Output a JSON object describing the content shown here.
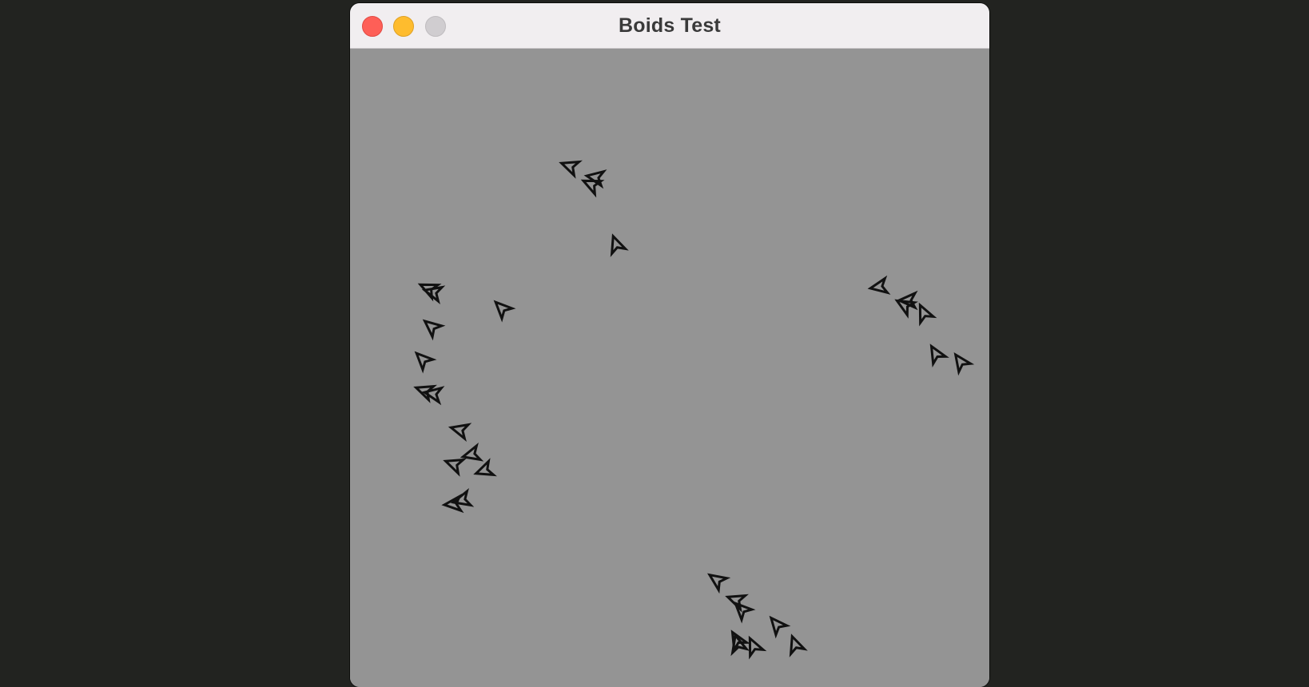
{
  "window": {
    "title": "Boids Test"
  },
  "colors": {
    "desktop": "#222320",
    "titlebar": "#f1eef0",
    "canvas": "#949494",
    "boid_stroke": "#111111",
    "close": "#fe5f57",
    "minimize": "#febc2e",
    "zoom": "#d0cdd0"
  },
  "controls": {
    "close": "close-button",
    "minimize": "minimize-button",
    "zoom": "zoom-button"
  },
  "boids": [
    {
      "heading": 200
    },
    {
      "heading": 190
    },
    {
      "heading": 205
    },
    {
      "heading": 250
    },
    {
      "heading": 205
    },
    {
      "heading": 195
    },
    {
      "heading": 225
    },
    {
      "heading": 220
    },
    {
      "heading": 225
    },
    {
      "heading": 200
    },
    {
      "heading": 190
    },
    {
      "heading": 195
    },
    {
      "heading": 200
    },
    {
      "heading": 165
    },
    {
      "heading": 160
    },
    {
      "heading": 175
    },
    {
      "heading": 165
    },
    {
      "heading": 170
    },
    {
      "heading": 180
    },
    {
      "heading": 210
    },
    {
      "heading": 245
    },
    {
      "heading": 240
    },
    {
      "heading": 235
    },
    {
      "heading": 215
    },
    {
      "heading": 200
    },
    {
      "heading": 225
    },
    {
      "heading": 230
    },
    {
      "heading": 240
    },
    {
      "heading": 245
    },
    {
      "heading": 250
    },
    {
      "heading": 255
    }
  ]
}
